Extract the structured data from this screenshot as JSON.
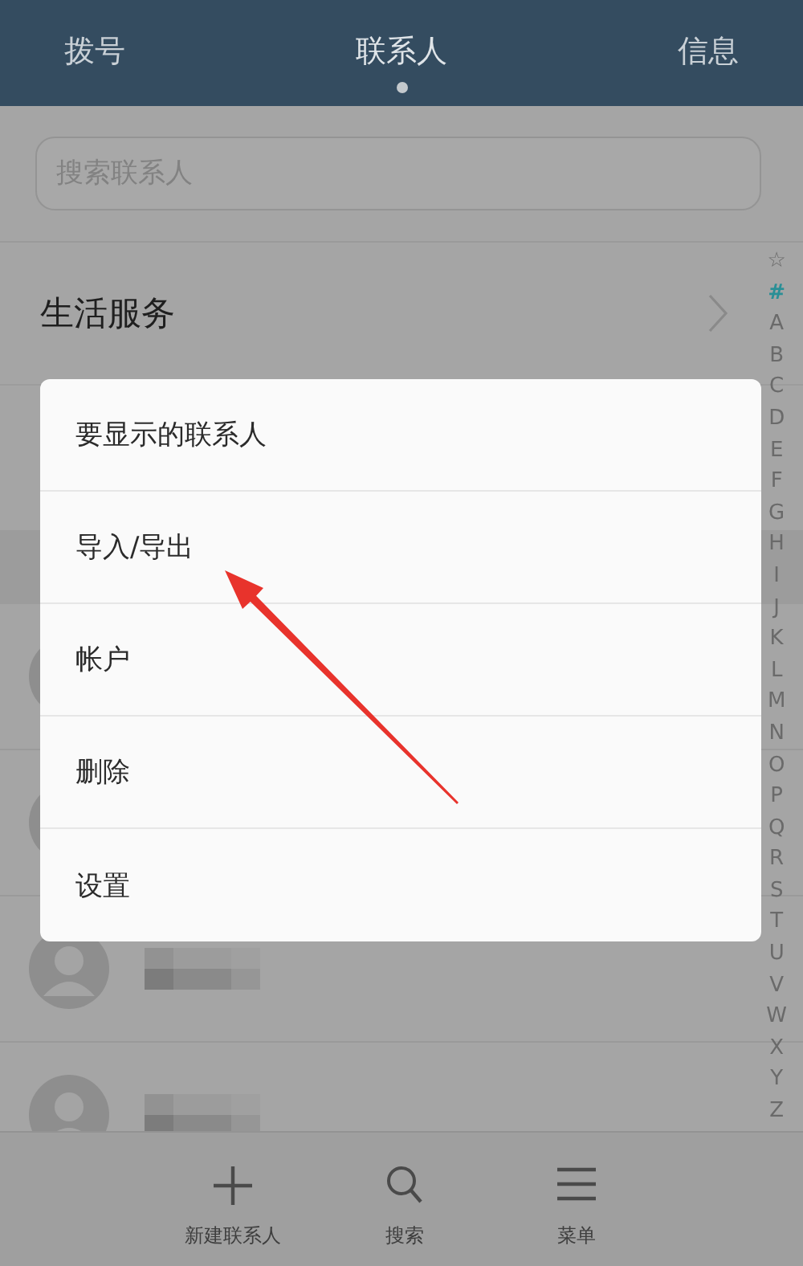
{
  "tabs": [
    {
      "label": "拨号",
      "selected": false
    },
    {
      "label": "联系人",
      "selected": true
    },
    {
      "label": "信息",
      "selected": false
    }
  ],
  "search": {
    "placeholder": "搜索联系人"
  },
  "service_row": {
    "label": "生活服务"
  },
  "index_bar": [
    {
      "label": "☆",
      "selected": false
    },
    {
      "label": "#",
      "selected": true
    },
    {
      "label": "A",
      "selected": false
    },
    {
      "label": "B",
      "selected": false
    },
    {
      "label": "C",
      "selected": false
    },
    {
      "label": "D",
      "selected": false
    },
    {
      "label": "E",
      "selected": false
    },
    {
      "label": "F",
      "selected": false
    },
    {
      "label": "G",
      "selected": false
    },
    {
      "label": "H",
      "selected": false
    },
    {
      "label": "I",
      "selected": false
    },
    {
      "label": "J",
      "selected": false
    },
    {
      "label": "K",
      "selected": false
    },
    {
      "label": "L",
      "selected": false
    },
    {
      "label": "M",
      "selected": false
    },
    {
      "label": "N",
      "selected": false
    },
    {
      "label": "O",
      "selected": false
    },
    {
      "label": "P",
      "selected": false
    },
    {
      "label": "Q",
      "selected": false
    },
    {
      "label": "R",
      "selected": false
    },
    {
      "label": "S",
      "selected": false
    },
    {
      "label": "T",
      "selected": false
    },
    {
      "label": "U",
      "selected": false
    },
    {
      "label": "V",
      "selected": false
    },
    {
      "label": "W",
      "selected": false
    },
    {
      "label": "X",
      "selected": false
    },
    {
      "label": "Y",
      "selected": false
    },
    {
      "label": "Z",
      "selected": false
    }
  ],
  "contacts": [
    {
      "kind": "hidden"
    },
    {
      "kind": "hidden"
    },
    {
      "kind": "redacted"
    },
    {
      "kind": "redacted"
    }
  ],
  "menu": {
    "items": [
      "要显示的联系人",
      "导入/导出",
      "帐户",
      "删除",
      "设置"
    ]
  },
  "bottom_bar": [
    {
      "kind": "add",
      "label": "新建联系人"
    },
    {
      "kind": "search",
      "label": "搜索"
    },
    {
      "kind": "menu",
      "label": "菜单"
    }
  ]
}
